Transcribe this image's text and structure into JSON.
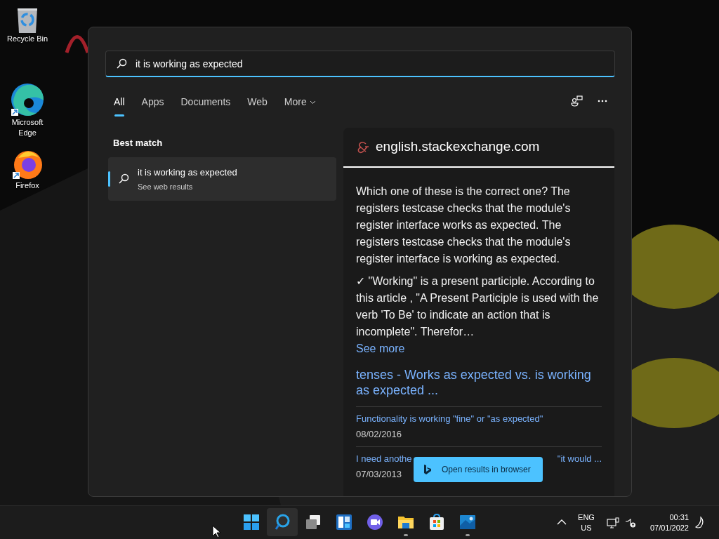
{
  "desktop_icons": [
    {
      "kind": "recycle",
      "label": "Recycle Bin"
    },
    {
      "kind": "edge",
      "label": "Microsoft Edge"
    },
    {
      "kind": "firefox",
      "label": "Firefox"
    }
  ],
  "search": {
    "value": "it is working as expected"
  },
  "tabs": [
    {
      "label": "All",
      "selected": true,
      "kind": "plain"
    },
    {
      "label": "Apps",
      "selected": false,
      "kind": "plain"
    },
    {
      "label": "Documents",
      "selected": false,
      "kind": "plain"
    },
    {
      "label": "Web",
      "selected": false,
      "kind": "plain"
    },
    {
      "label": "More",
      "selected": false,
      "kind": "dropdown"
    }
  ],
  "best_match": {
    "heading": "Best match",
    "title": "it is working as expected",
    "subtitle": "See web results",
    "selected": true
  },
  "preview": {
    "site": "english.stackexchange.com",
    "paragraphs": [
      "Which one of these is the correct one? The registers testcase checks that the module's register interface works as expected. The registers testcase checks that the module's register interface is working as expected.",
      "✓ \"Working\" is a present participle. According to this article , \"A Present Participle is used with the verb 'To Be' to indicate an action that is incomplete\". Therefor…"
    ],
    "see_more": "See more",
    "link_title": "tenses - Works as expected vs. is working as expected ...",
    "results": [
      {
        "title_parts": [
          "Functionality is working \"fine\" or \"as expected\""
        ],
        "date": "08/02/2016"
      },
      {
        "title_parts": [
          "I need anothe",
          "\"it would ..."
        ],
        "date": "07/03/2013"
      }
    ]
  },
  "open_button": {
    "label": "Open results in browser"
  },
  "taskbar": {
    "apps": [
      {
        "kind": "start",
        "selected": false,
        "running": false
      },
      {
        "kind": "search",
        "selected": true,
        "running": false
      },
      {
        "kind": "taskview",
        "selected": false,
        "running": false
      },
      {
        "kind": "widgets",
        "selected": false,
        "running": false
      },
      {
        "kind": "chat",
        "selected": false,
        "running": false
      },
      {
        "kind": "explorer",
        "selected": false,
        "running": true
      },
      {
        "kind": "store",
        "selected": false,
        "running": false
      },
      {
        "kind": "photos",
        "selected": false,
        "running": true
      }
    ],
    "language": "ENG",
    "region": "US",
    "time": "00:31",
    "date": "07/01/2022"
  }
}
